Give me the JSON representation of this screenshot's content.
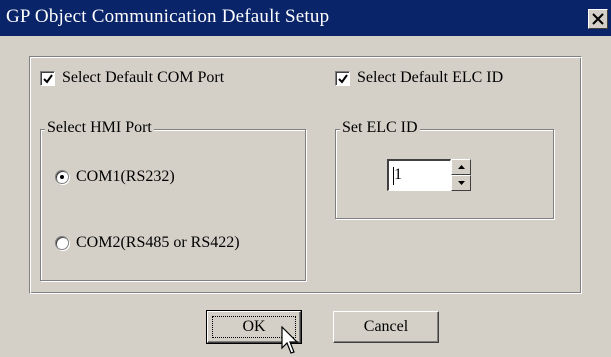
{
  "window": {
    "title": "GP Object Communication Default Setup",
    "close_glyph": "✕"
  },
  "options": {
    "com_port_checkbox": {
      "label": "Select Default COM Port",
      "checked": true
    },
    "elc_id_checkbox": {
      "label": "Select Default ELC ID",
      "checked": true
    }
  },
  "hmi_port": {
    "group_label": "Select HMI Port",
    "options": [
      {
        "label": "COM1(RS232)",
        "selected": true
      },
      {
        "label": "COM2(RS485 or RS422)",
        "selected": false
      }
    ]
  },
  "elc_id": {
    "group_label": "Set ELC ID",
    "value": "1"
  },
  "buttons": {
    "ok": "OK",
    "cancel": "Cancel"
  },
  "icons": {
    "close": "close-icon",
    "check": "check-icon",
    "spin_up": "spin-up-arrow-icon",
    "spin_down": "spin-down-arrow-icon",
    "cursor": "mouse-pointer-icon"
  },
  "colors": {
    "titlebar": "#0a246a",
    "title_text": "#ffffff",
    "dialog_face": "#d4d0c8"
  }
}
